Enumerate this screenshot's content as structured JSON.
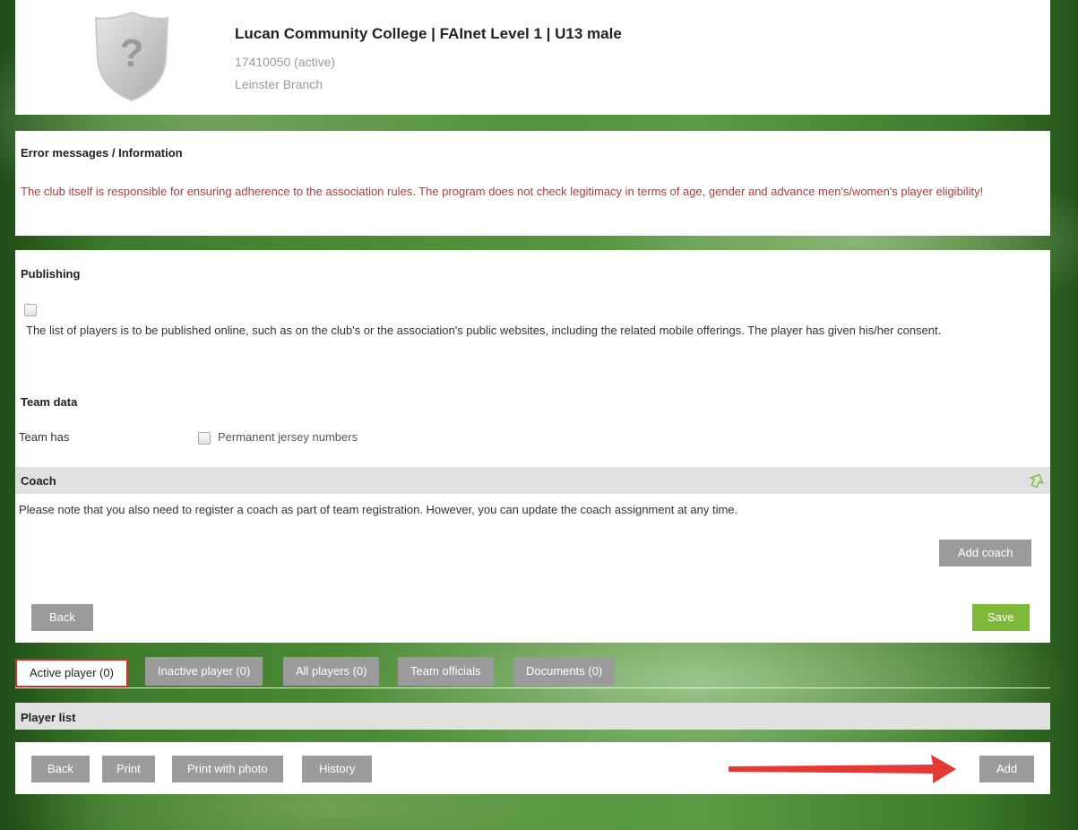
{
  "header": {
    "title": "Lucan Community College | FAInet Level 1 | U13 male",
    "id_status": "17410050 (active)",
    "branch": "Leinster Branch"
  },
  "errors": {
    "heading": "Error messages / Information",
    "message": "The club itself is responsible for ensuring adherence to the association rules. The program does not check legitimacy in terms of age, gender and advance men's/women's player eligibility!"
  },
  "publishing": {
    "heading": "Publishing",
    "consent_text": "The list of players is to be published online, such as on the club's or the association's public websites, including the related mobile offerings. The player has given his/her consent."
  },
  "team_data": {
    "heading": "Team data",
    "label": "Team has",
    "option": "Permanent jersey numbers"
  },
  "coach": {
    "heading": "Coach",
    "note": "Please note that you also need to register a coach as part of team registration. However, you can update the coach assignment at any time.",
    "add_label": "Add coach"
  },
  "form_actions": {
    "back_label": "Back",
    "save_label": "Save"
  },
  "tabs": [
    {
      "label": "Active player (0)",
      "active": true
    },
    {
      "label": "Inactive player (0)",
      "active": false
    },
    {
      "label": "All players (0)",
      "active": false
    },
    {
      "label": "Team officials",
      "active": false
    },
    {
      "label": "Documents (0)",
      "active": false
    }
  ],
  "player_list": {
    "heading": "Player list"
  },
  "list_actions": {
    "back_label": "Back",
    "print_label": "Print",
    "print_photo_label": "Print with photo",
    "history_label": "History",
    "add_label": "Add"
  },
  "colors": {
    "accent_green": "#7fb93a",
    "error_red": "#b03a3a",
    "highlight_red": "#d32f2f",
    "button_gray": "#9b9b9b"
  }
}
